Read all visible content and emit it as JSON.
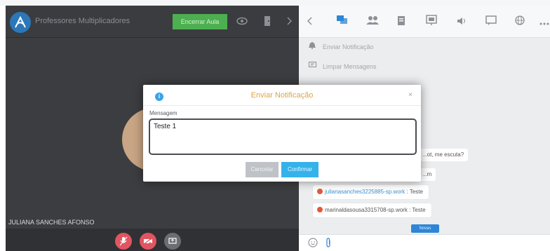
{
  "video": {
    "room_name": "Professores Multiplicadores",
    "end_class_label": "Encerrar Aula",
    "participant_name": "JULIANA SANCHES AFONSO"
  },
  "chat": {
    "menu": {
      "send_notification": "Enviar Notificação",
      "clear_messages": "Limpar Mensagens"
    },
    "partial_messages": [
      "...ot, me escuta?",
      "...m"
    ],
    "messages": [
      {
        "sender": "julianasanches3225885-sp.work",
        "text": "Teste"
      },
      {
        "sender": "marinaldasousa3315708-sp.work",
        "text": "Teste"
      }
    ],
    "new_badge": "Novas"
  },
  "modal": {
    "title": "Enviar Notificação",
    "close_glyph": "×",
    "field_label": "Mensagem",
    "message_value": "Teste 1",
    "cancel_label": "Cancelar",
    "confirm_label": "Confirmar"
  },
  "colors": {
    "accent_blue": "#2f86d6",
    "confirm_blue": "#35b2ea",
    "end_class_green": "#4caf50",
    "title_orange": "#e0a43e",
    "alert_red": "#e05561",
    "video_bg": "#3b3d40"
  },
  "icons": {
    "header": [
      "app-logo-icon",
      "eye-icon",
      "door-icon",
      "chevron-right-icon"
    ],
    "toolbar": [
      "chevron-left-icon",
      "chat-icon",
      "people-icon",
      "clipboard-icon",
      "whiteboard-icon",
      "speaker-icon",
      "comment-icon",
      "globe-icon",
      "more-icon"
    ],
    "controls": [
      "mic-off-icon",
      "camera-off-icon",
      "screen-share-icon"
    ],
    "input": [
      "emoji-icon",
      "attach-icon"
    ]
  }
}
